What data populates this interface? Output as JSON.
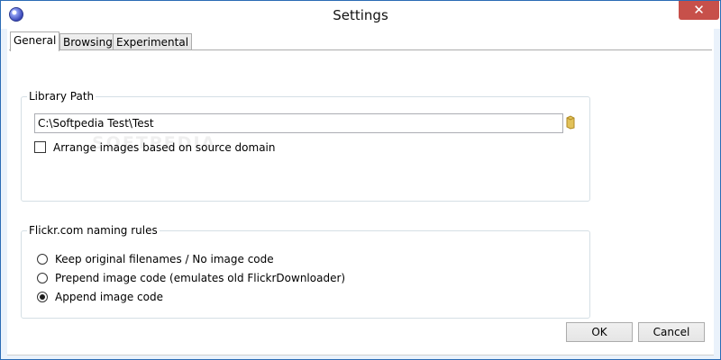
{
  "window": {
    "title": "Settings",
    "close_glyph": "✕"
  },
  "tabs": [
    {
      "label": "General",
      "active": true
    },
    {
      "label": "Browsing",
      "active": false
    },
    {
      "label": "Experimental",
      "active": false
    }
  ],
  "library": {
    "group_label": "Library Path",
    "path_value": "C:\\Softpedia Test\\Test",
    "arrange_label": "Arrange images based on source domain",
    "arrange_checked": false,
    "browse_icon": "folder-icon"
  },
  "flickr": {
    "group_label": "Flickr.com naming rules",
    "options": [
      {
        "label": "Keep original filenames / No image code",
        "selected": false
      },
      {
        "label": "Prepend image code (emulates old FlickrDownloader)",
        "selected": false
      },
      {
        "label": "Append image code",
        "selected": true
      }
    ]
  },
  "buttons": {
    "ok": "OK",
    "cancel": "Cancel"
  },
  "watermark": "SOFTPEDIA",
  "colors": {
    "accent": "#2b6cb5",
    "close": "#c7504a",
    "frame": "#eaf2fb"
  }
}
